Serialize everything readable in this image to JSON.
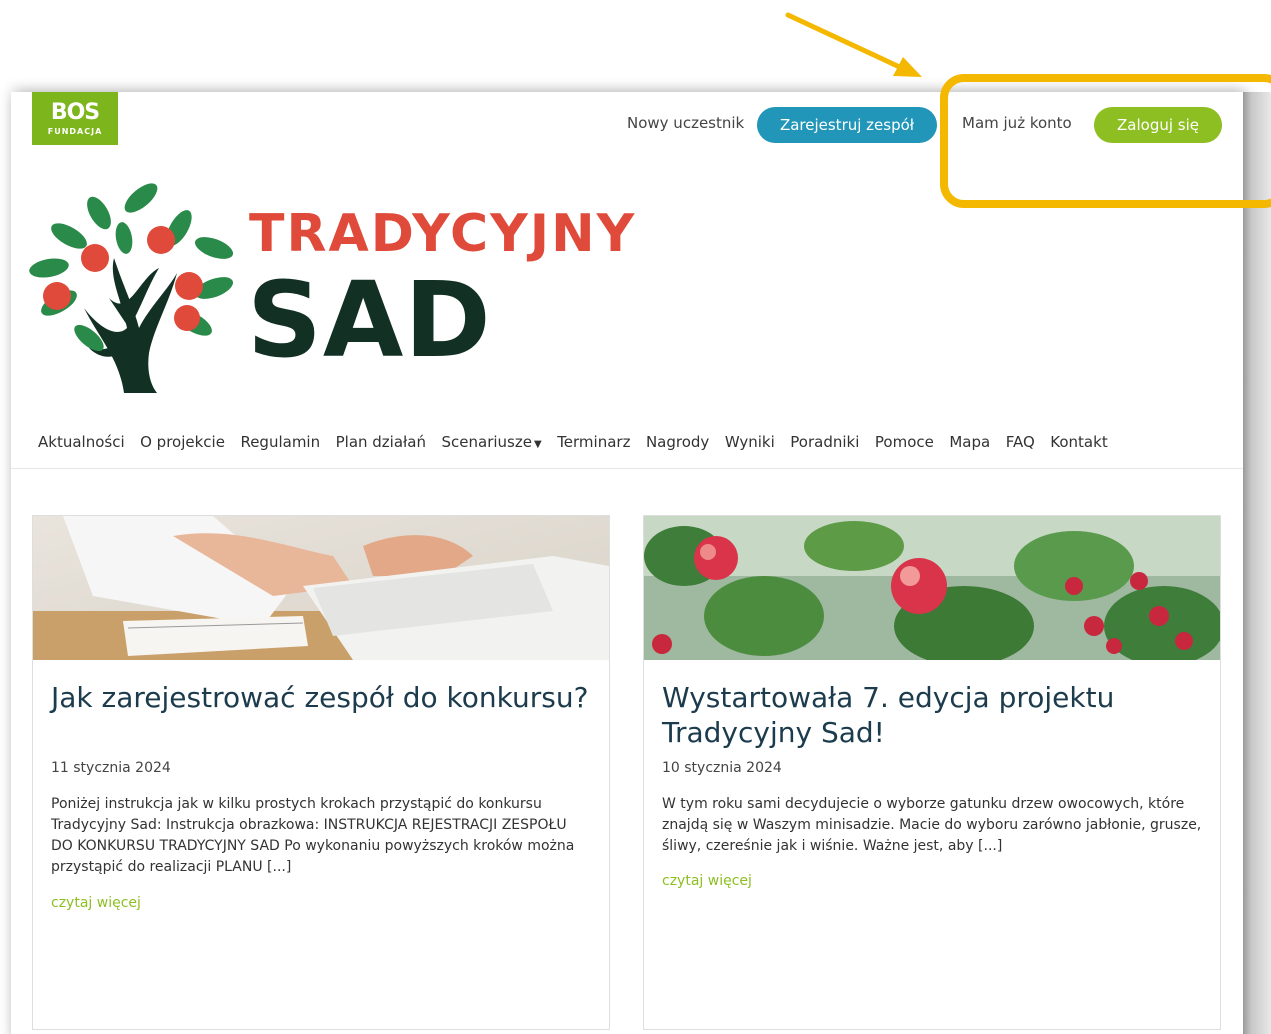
{
  "header": {
    "logo_main": "BOS",
    "logo_sub": "FUNDACJA",
    "new_participant_label": "Nowy uczestnik",
    "register_button": "Zarejestruj zespół",
    "have_account_label": "Mam już konto",
    "login_button": "Zaloguj się"
  },
  "brand": {
    "line1": "TRADYCYJNY",
    "line2": "SAD"
  },
  "nav": {
    "items": [
      {
        "label": "Aktualności"
      },
      {
        "label": "O projekcie"
      },
      {
        "label": "Regulamin"
      },
      {
        "label": "Plan działań"
      },
      {
        "label": "Scenariusze",
        "dropdown": true
      },
      {
        "label": "Terminarz"
      },
      {
        "label": "Nagrody"
      },
      {
        "label": "Wyniki"
      },
      {
        "label": "Poradniki"
      },
      {
        "label": "Pomoce"
      },
      {
        "label": "Mapa"
      },
      {
        "label": "FAQ"
      },
      {
        "label": "Kontakt"
      }
    ]
  },
  "posts": [
    {
      "title": "Jak zarejestrować zespół do konkursu?",
      "date": "11 stycznia 2024",
      "excerpt": "Poniżej instrukcja jak w kilku prostych krokach przystąpić do konkursu Tradycyjny Sad:   Instrukcja obrazkowa: INSTRUKCJA REJESTRACJI ZESPOŁU DO KONKURSU TRADYCYJNY SAD Po wykonaniu powyższych kroków można przystąpić do realizacji PLANU [...]",
      "more": "czytaj więcej"
    },
    {
      "title": "Wystartowała 7. edycja projektu Tradycyjny Sad!",
      "date": "10 stycznia 2024",
      "excerpt": "W tym roku sami decydujecie o wyborze gatunku drzew owocowych, które znajdą się w Waszym minisadzie. Macie do wyboru zarówno jabłonie, grusze, śliwy, czereśnie jak i wiśnie. Ważne jest, aby [...]",
      "more": "czytaj więcej"
    }
  ],
  "colors": {
    "register": "#2196b9",
    "login": "#8dbf22",
    "brand_red": "#e04a3a",
    "brand_dark": "#123024",
    "annotation": "#f5b800"
  }
}
